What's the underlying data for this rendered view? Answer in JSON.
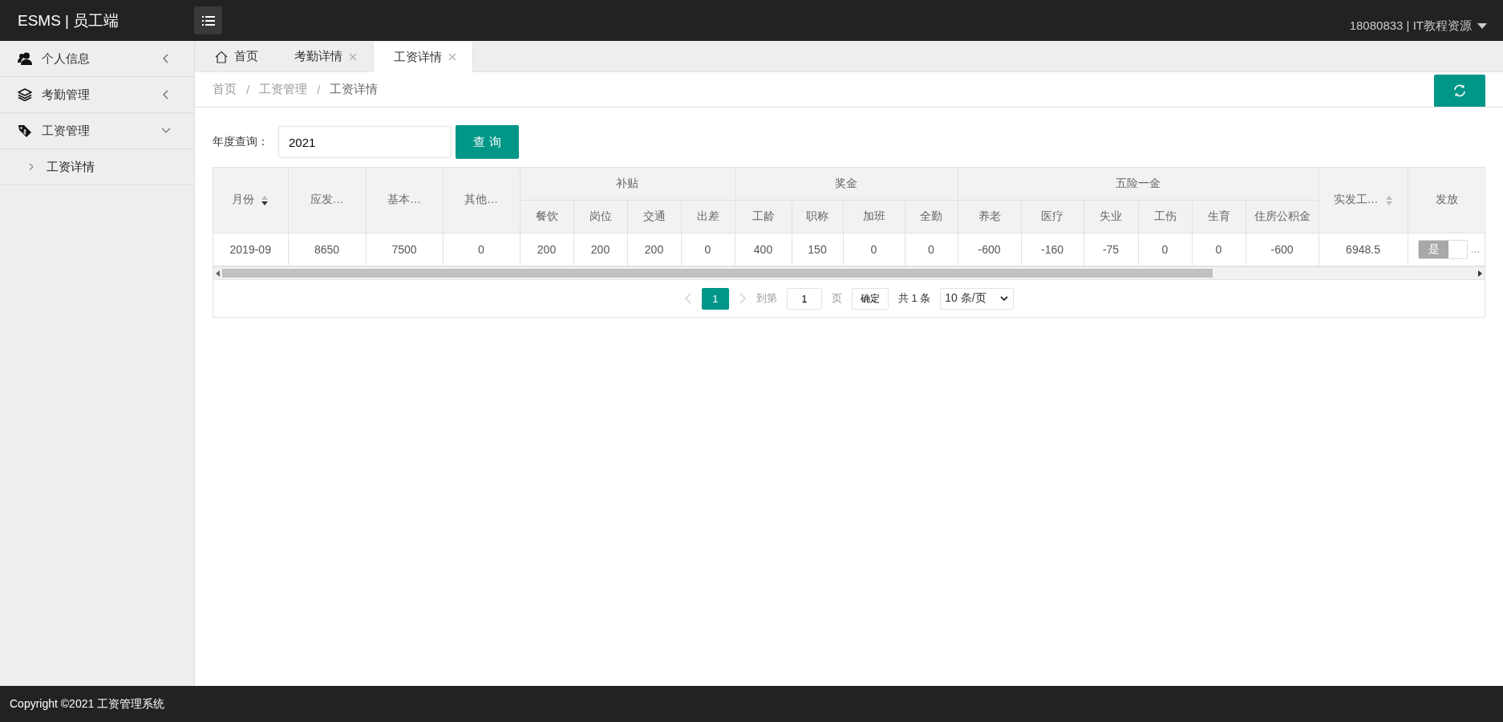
{
  "header": {
    "brand": "ESMS | 员工端",
    "user": "18080833 | IT教程资源"
  },
  "sidebar": {
    "items": [
      {
        "label": "个人信息",
        "expanded": false
      },
      {
        "label": "考勤管理",
        "expanded": false
      },
      {
        "label": "工资管理",
        "expanded": true,
        "children": [
          {
            "label": "工资详情",
            "selected": true
          }
        ]
      }
    ]
  },
  "tabs": [
    {
      "label": "首页",
      "home": true,
      "closable": false,
      "selected": false
    },
    {
      "label": "考勤详情",
      "home": false,
      "closable": true,
      "selected": false
    },
    {
      "label": "工资详情",
      "home": false,
      "closable": true,
      "selected": true
    }
  ],
  "breadcrumb": [
    {
      "label": "首页"
    },
    {
      "separator": "/",
      "label": "工资管理"
    },
    {
      "separator": "/",
      "label": "工资详情"
    }
  ],
  "query": {
    "label": "年度查询：",
    "value": "2021",
    "button": "查 询"
  },
  "table": {
    "columns": [
      {
        "label": "月份",
        "sorted": true
      },
      {
        "label": "应发…"
      },
      {
        "label": "基本…"
      },
      {
        "label": "其他…"
      },
      {
        "label": "补贴",
        "colspan": 4,
        "children": [
          {
            "label": "餐饮"
          },
          {
            "label": "岗位"
          },
          {
            "label": "交通"
          },
          {
            "label": "出差"
          }
        ]
      },
      {
        "label": "奖金",
        "colspan": 4,
        "children": [
          {
            "label": "工龄"
          },
          {
            "label": "职称"
          },
          {
            "label": "加班"
          },
          {
            "label": "全勤"
          }
        ]
      },
      {
        "label": "五险一金",
        "colspan": 6,
        "children": [
          {
            "label": "养老"
          },
          {
            "label": "医疗"
          },
          {
            "label": "失业"
          },
          {
            "label": "工伤"
          },
          {
            "label": "生育"
          },
          {
            "label": "住房公积金"
          }
        ]
      },
      {
        "label": "实发工…",
        "sorted": false
      },
      {
        "label": "发放"
      }
    ],
    "rows": [
      {
        "cells": [
          "2019-09",
          "8650",
          "7500",
          "0",
          "200",
          "200",
          "200",
          "0",
          "400",
          "150",
          "0",
          "0",
          "-600",
          "-160",
          "-75",
          "0",
          "0",
          "-600",
          "6948.5"
        ],
        "issued": {
          "label": "是",
          "on": false
        },
        "overflow": "…"
      }
    ]
  },
  "pagination": {
    "pages": [
      {
        "label": "1",
        "selected": true
      }
    ],
    "goto_label": "到第",
    "goto_value": "1",
    "page_unit": "页",
    "confirm": "确定",
    "total": "共 1 条",
    "page_size": "10 条/页"
  },
  "footer": "Copyright ©2021 工资管理系统"
}
